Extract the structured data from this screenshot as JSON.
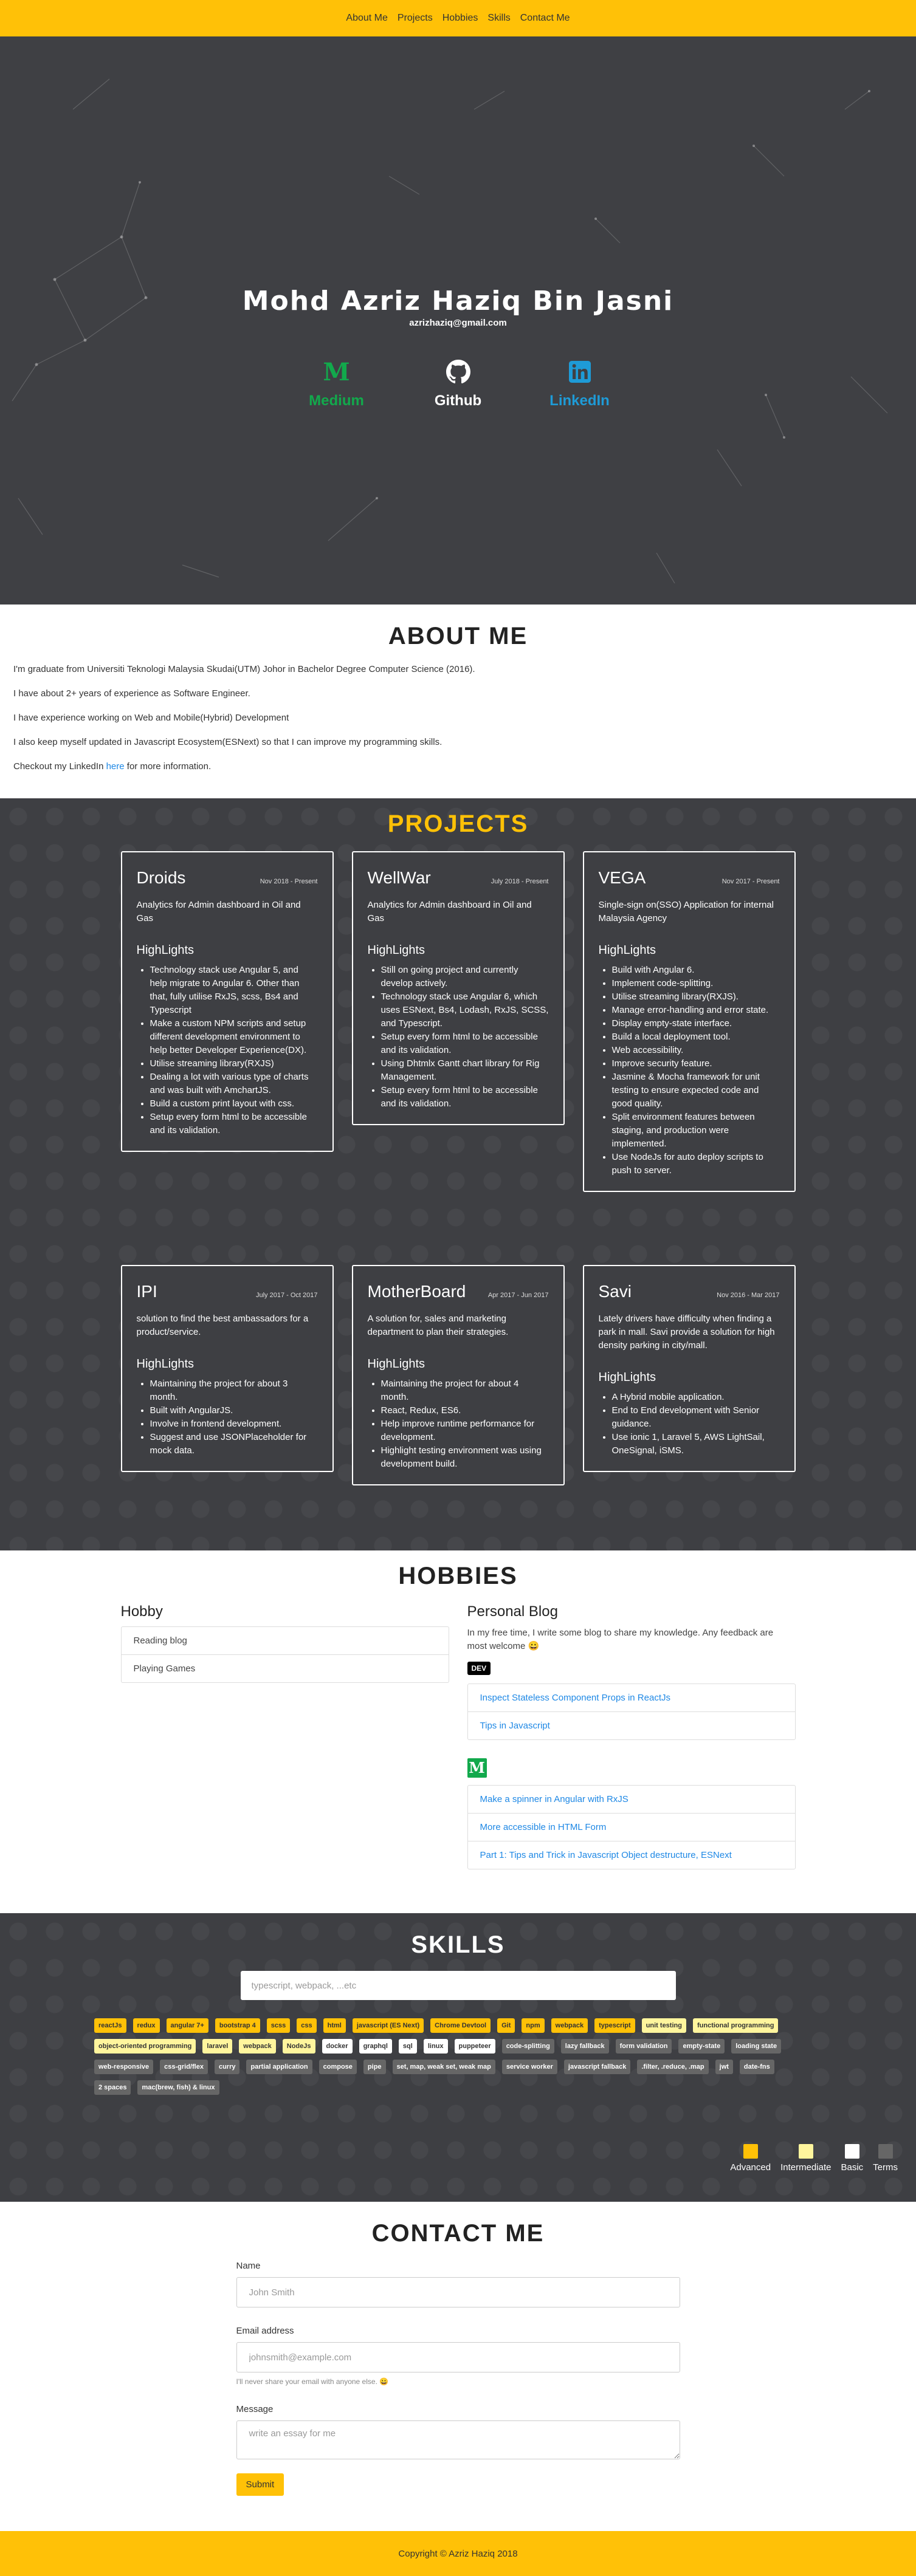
{
  "nav": {
    "items": [
      "About Me",
      "Projects",
      "Hobbies",
      "Skills",
      "Contact Me"
    ]
  },
  "hero": {
    "name": "Mohd Azriz Haziq Bin Jasni",
    "email": "azrizhaziq@gmail.com",
    "social": [
      {
        "label": "Medium",
        "icon": "medium-icon",
        "color": "#12A94C"
      },
      {
        "label": "Github",
        "icon": "github-icon",
        "color": "#FFFFFF"
      },
      {
        "label": "LinkedIn",
        "icon": "linkedin-icon",
        "color": "#1E9BD7"
      }
    ]
  },
  "about": {
    "title": "ABOUT ME",
    "paragraphs": [
      "I'm graduate from Universiti Teknologi Malaysia Skudai(UTM) Johor in Bachelor Degree Computer Science (2016).",
      "I have about 2+ years of experience as Software Engineer.",
      "I have experience working on Web and Mobile(Hybrid) Development",
      "I also keep myself updated in Javascript Ecosystem(ESNext) so that I can improve my programming skills."
    ],
    "linkedin_prefix": "Checkout my LinkedIn ",
    "linkedin_link": "here",
    "linkedin_suffix": " for more information."
  },
  "projects": {
    "title": "PROJECTS",
    "highlights_label": "HighLights",
    "items": [
      {
        "title": "Droids",
        "date": "Nov 2018 - Present",
        "desc": "Analytics for Admin dashboard in Oil and Gas",
        "highlights": [
          "Technology stack use Angular 5, and help migrate to Angular 6. Other than that, fully utilise RxJS, scss, Bs4 and Typescript",
          "Make a custom NPM scripts and setup different development environment to help better Developer Experience(DX).",
          "Utilise streaming library(RXJS)",
          "Dealing a lot with various type of charts and was built with AmchartJS.",
          "Build a custom print layout with css.",
          "Setup every form html to be accessible and its validation."
        ]
      },
      {
        "title": "WellWar",
        "date": "July 2018 - Present",
        "desc": "Analytics for Admin dashboard in Oil and Gas",
        "highlights": [
          "Still on going project and currently develop actively.",
          "Technology stack use Angular 6, which uses ESNext, Bs4, Lodash, RxJS, SCSS, and Typescript.",
          "Setup every form html to be accessible and its validation.",
          "Using Dhtmlx Gantt chart library for Rig Management.",
          "Setup every form html to be accessible and its validation."
        ]
      },
      {
        "title": "VEGA",
        "date": "Nov 2017 - Present",
        "desc": "Single-sign on(SSO) Application for internal Malaysia Agency",
        "highlights": [
          "Build with Angular 6.",
          "Implement code-splitting.",
          "Utilise streaming library(RXJS).",
          "Manage error-handling and error state.",
          "Display empty-state interface.",
          "Build a local deployment tool.",
          "Web accessibility.",
          "Improve security feature.",
          "Jasmine & Mocha framework for unit testing to ensure expected code and good quality.",
          "Split environment features between staging, and production were implemented.",
          "Use NodeJs for auto deploy scripts to push to server."
        ]
      },
      {
        "title": "IPI",
        "date": "July 2017 - Oct 2017",
        "desc": "solution to find the best ambassadors for a product/service.",
        "highlights": [
          "Maintaining the project for about 3 month.",
          "Built with AngularJS.",
          "Involve in frontend development.",
          "Suggest and use JSONPlaceholder for mock data."
        ]
      },
      {
        "title": "MotherBoard",
        "date": "Apr 2017 - Jun 2017",
        "desc": "A solution for, sales and marketing department to plan their strategies.",
        "highlights": [
          "Maintaining the project for about 4 month.",
          "React, Redux, ES6.",
          "Help improve runtime performance for development.",
          "Highlight testing environment was using development build."
        ]
      },
      {
        "title": "Savi",
        "date": "Nov 2016 - Mar 2017",
        "desc": "Lately drivers have difficulty when finding a park in mall. Savi provide a solution for high density parking in city/mall.",
        "highlights": [
          "A Hybrid mobile application.",
          "End to End development with Senior guidance.",
          "Use ionic 1, Laravel 5, AWS LightSail, OneSignal, iSMS."
        ]
      }
    ]
  },
  "hobbies": {
    "title": "HOBBIES",
    "hobby_heading": "Hobby",
    "hobby_items": [
      "Reading blog",
      "Playing Games"
    ],
    "blog_heading": "Personal Blog",
    "blog_intro": "In my free time, I write some blog to share my knowledge. Any feedback are most welcome 😀",
    "dev_badge": "DEV",
    "dev_posts": [
      "Inspect Stateless Component Props in ReactJs",
      "Tips in Javascript"
    ],
    "medium_badge": "M",
    "medium_posts": [
      "Make a spinner in Angular with RxJS",
      "More accessible in HTML Form",
      "Part 1: Tips and Trick in Javascript Object destructure, ESNext"
    ]
  },
  "skills": {
    "title": "SKILLS",
    "search_placeholder": "typescript, webpack, ...etc",
    "tags": [
      {
        "label": "reactJs",
        "level": "adv"
      },
      {
        "label": "redux",
        "level": "adv"
      },
      {
        "label": "angular 7+",
        "level": "adv"
      },
      {
        "label": "bootstrap 4",
        "level": "adv"
      },
      {
        "label": "scss",
        "level": "adv"
      },
      {
        "label": "css",
        "level": "adv"
      },
      {
        "label": "html",
        "level": "adv"
      },
      {
        "label": "javascript (ES Next)",
        "level": "adv"
      },
      {
        "label": "Chrome Devtool",
        "level": "adv"
      },
      {
        "label": "Git",
        "level": "adv"
      },
      {
        "label": "npm",
        "level": "adv"
      },
      {
        "label": "webpack",
        "level": "adv"
      },
      {
        "label": "typescript",
        "level": "adv"
      },
      {
        "label": "unit testing",
        "level": "int"
      },
      {
        "label": "functional programming",
        "level": "int"
      },
      {
        "label": "object-oriented programming",
        "level": "int"
      },
      {
        "label": "laravel",
        "level": "int"
      },
      {
        "label": "webpack",
        "level": "int"
      },
      {
        "label": "NodeJs",
        "level": "int"
      },
      {
        "label": "docker",
        "level": "bas"
      },
      {
        "label": "graphql",
        "level": "bas"
      },
      {
        "label": "sql",
        "level": "bas"
      },
      {
        "label": "linux",
        "level": "bas"
      },
      {
        "label": "puppeteer",
        "level": "bas"
      },
      {
        "label": "code-splitting",
        "level": "trm"
      },
      {
        "label": "lazy fallback",
        "level": "trm"
      },
      {
        "label": "form validation",
        "level": "trm"
      },
      {
        "label": "empty-state",
        "level": "trm"
      },
      {
        "label": "loading state",
        "level": "trm"
      },
      {
        "label": "web-responsive",
        "level": "trm"
      },
      {
        "label": "css-grid/flex",
        "level": "trm"
      },
      {
        "label": "curry",
        "level": "trm"
      },
      {
        "label": "partial application",
        "level": "trm"
      },
      {
        "label": "compose",
        "level": "trm"
      },
      {
        "label": "pipe",
        "level": "trm"
      },
      {
        "label": "set, map, weak set, weak map",
        "level": "trm"
      },
      {
        "label": "service worker",
        "level": "trm"
      },
      {
        "label": "javascript fallback",
        "level": "trm"
      },
      {
        "label": ".filter, .reduce, .map",
        "level": "trm"
      },
      {
        "label": "jwt",
        "level": "trm"
      },
      {
        "label": "date-fns",
        "level": "trm"
      },
      {
        "label": "2 spaces",
        "level": "trm"
      },
      {
        "label": "mac(brew, fish) & linux",
        "level": "trm"
      }
    ],
    "legend": [
      {
        "label": "Advanced",
        "color": "#FFC107"
      },
      {
        "label": "Intermediate",
        "color": "#FFF59D"
      },
      {
        "label": "Basic",
        "color": "#FFFFFF"
      },
      {
        "label": "Terms",
        "color": "#666666"
      }
    ]
  },
  "contact": {
    "title": "CONTACT ME",
    "name_label": "Name",
    "name_placeholder": "John Smith",
    "email_label": "Email address",
    "email_placeholder": "johnsmith@example.com",
    "email_help": "I'll never share your email with anyone else. 😀",
    "message_label": "Message",
    "message_placeholder": "write an essay for me",
    "submit_label": "Submit"
  },
  "footer": {
    "text": "Copyright © Azriz Haziq 2018"
  },
  "colors": {
    "accent": "#FFC107",
    "dark": "#3E3F43",
    "link": "#1E88E5"
  }
}
